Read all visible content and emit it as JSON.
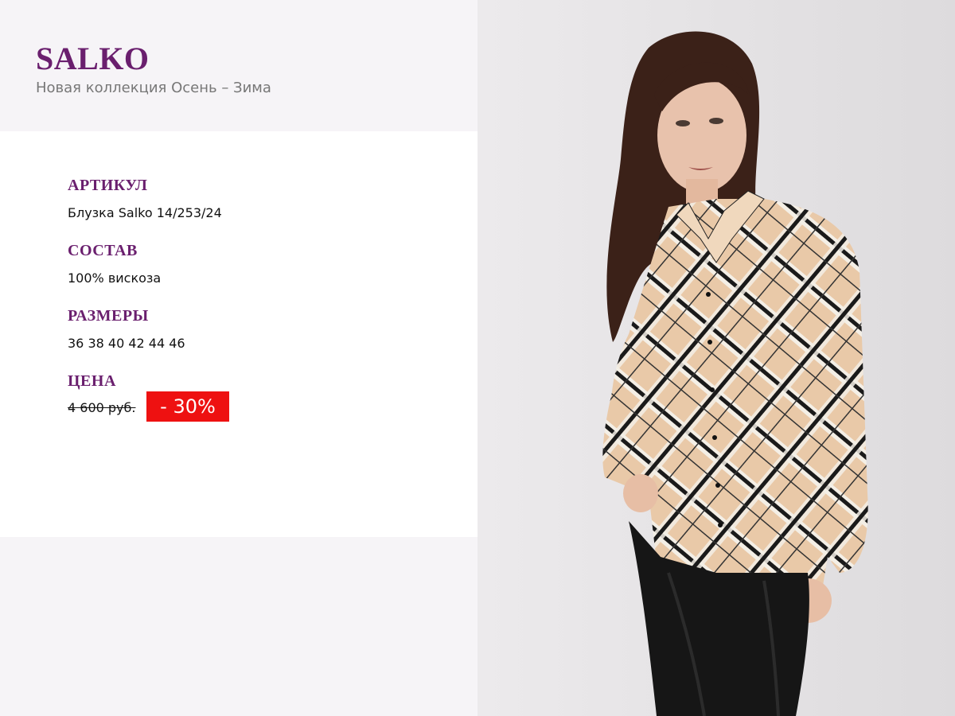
{
  "brand": {
    "name": "SALKO",
    "collection": "Новая коллекция Осень – Зима"
  },
  "product": {
    "article_title": "АРТИКУЛ",
    "article_value": "Блузка Salko 14/253/24",
    "composition_title": "СОСТАВ",
    "composition_value": "100% вискоза",
    "sizes_title": "РАЗМЕРЫ",
    "sizes_value": "36 38 40 42 44 46",
    "price_title": "ЦЕНА",
    "old_price": "4 600 руб.",
    "discount": "- 30%"
  },
  "photo": {
    "subject": "model-photo"
  },
  "colors": {
    "brand": "#6a1f6e",
    "discount_bg": "#ee1111"
  }
}
